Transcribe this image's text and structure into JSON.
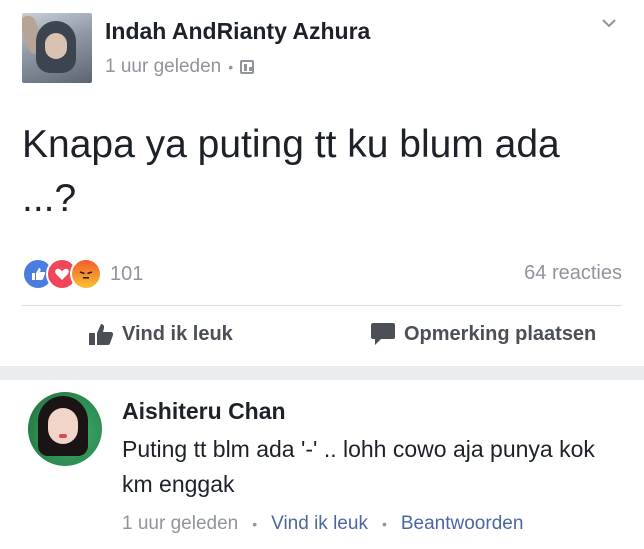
{
  "post": {
    "author": "Indah AndRianty Azhura",
    "timestamp": "1 uur geleden",
    "separator": "•",
    "privacy_icon": "group-privacy-icon",
    "menu_icon": "chevron-down-icon",
    "text": "Knapa ya puting tt ku blum ada ...?",
    "reactions": {
      "icons": [
        "like-reaction-icon",
        "love-reaction-icon",
        "angry-reaction-icon"
      ],
      "count": "101"
    },
    "comments_count": "64 reacties",
    "actions": {
      "like_label": "Vind ik leuk",
      "comment_label": "Opmerking plaatsen"
    }
  },
  "comment": {
    "author": "Aishiteru Chan",
    "text": "Puting tt blm ada '-' .. lohh cowo aja punya kok km enggak",
    "timestamp": "1 uur geleden",
    "dot": "•",
    "like_label": "Vind ik leuk",
    "reply_label": "Beantwoorden"
  },
  "colors": {
    "text": "#1d2129",
    "muted": "#90949c",
    "link": "#4b67a1",
    "like": "#4a7dde",
    "love": "#f0465a",
    "separator": "#e9ebee"
  }
}
